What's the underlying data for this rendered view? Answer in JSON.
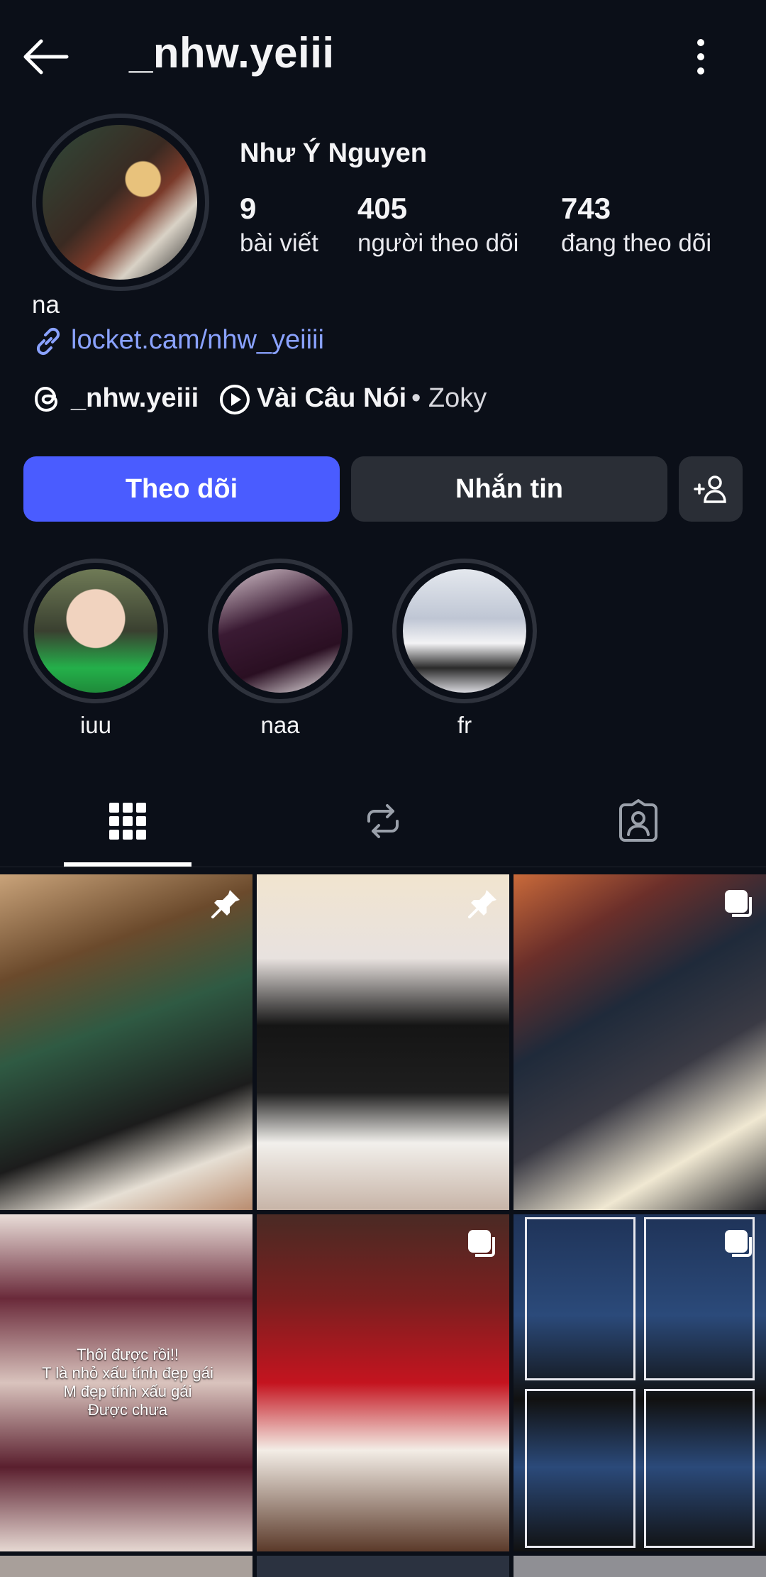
{
  "header": {
    "username": "_nhw.yeiii"
  },
  "profile": {
    "display_name": "Như Ý Nguyen",
    "stats": [
      {
        "value": "9",
        "label": "bài viết"
      },
      {
        "value": "405",
        "label": "người theo dõi"
      },
      {
        "value": "743",
        "label": "đang theo dõi"
      }
    ],
    "bio": "na",
    "link": "locket.cam/nhw_yeiiii",
    "threads_handle": "_nhw.yeiii",
    "music": {
      "title": "Vài Câu Nói",
      "artist": "• Zoky"
    }
  },
  "buttons": {
    "follow": "Theo dõi",
    "message": "Nhắn tin"
  },
  "highlights": [
    {
      "label": "iuu"
    },
    {
      "label": "naa"
    },
    {
      "label": "fr"
    }
  ],
  "tabs": [
    "posts-grid",
    "reposts",
    "tagged"
  ],
  "posts": [
    {
      "type": "pinned"
    },
    {
      "type": "pinned"
    },
    {
      "type": "carousel"
    },
    {
      "type": "image",
      "caption": "Thôi được rồi!!\nT là nhỏ xấu tính đẹp gái\nM đẹp tính xấu gái\nĐược chưa"
    },
    {
      "type": "carousel"
    },
    {
      "type": "carousel"
    }
  ],
  "colors": {
    "accent": "#4a5cff",
    "link": "#8aa2ff",
    "background": "#0b0f18"
  }
}
